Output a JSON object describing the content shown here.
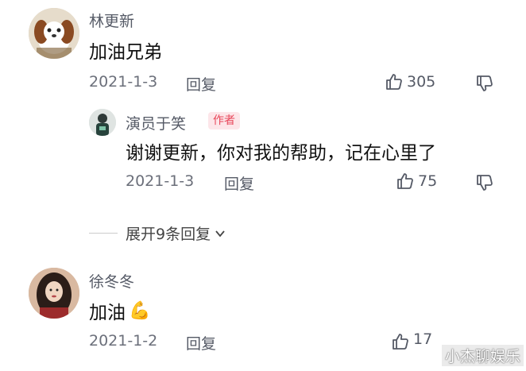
{
  "comments": [
    {
      "name": "林更新",
      "text": "加油兄弟",
      "date": "2021-1-3",
      "reply": "回复",
      "likes": "305",
      "avatar_icon": "dog-avatar"
    },
    {
      "name": "演员于笑",
      "badge": "作者",
      "text": "谢谢更新，你对我的帮助，记在心里了",
      "date": "2021-1-3",
      "reply": "回复",
      "likes": "75",
      "avatar_icon": "person-avatar"
    },
    {
      "name": "徐冬冬",
      "text": "加油",
      "emoji": "💪",
      "date": "2021-1-2",
      "reply": "回复",
      "likes": "17"
    }
  ],
  "expand_label": "展开9条回复",
  "watermark": "小杰聊娱乐",
  "colors": {
    "accent_red": "#e8475a",
    "badge_bg": "#fde6e9",
    "meta_gray": "#6b6f7a"
  }
}
